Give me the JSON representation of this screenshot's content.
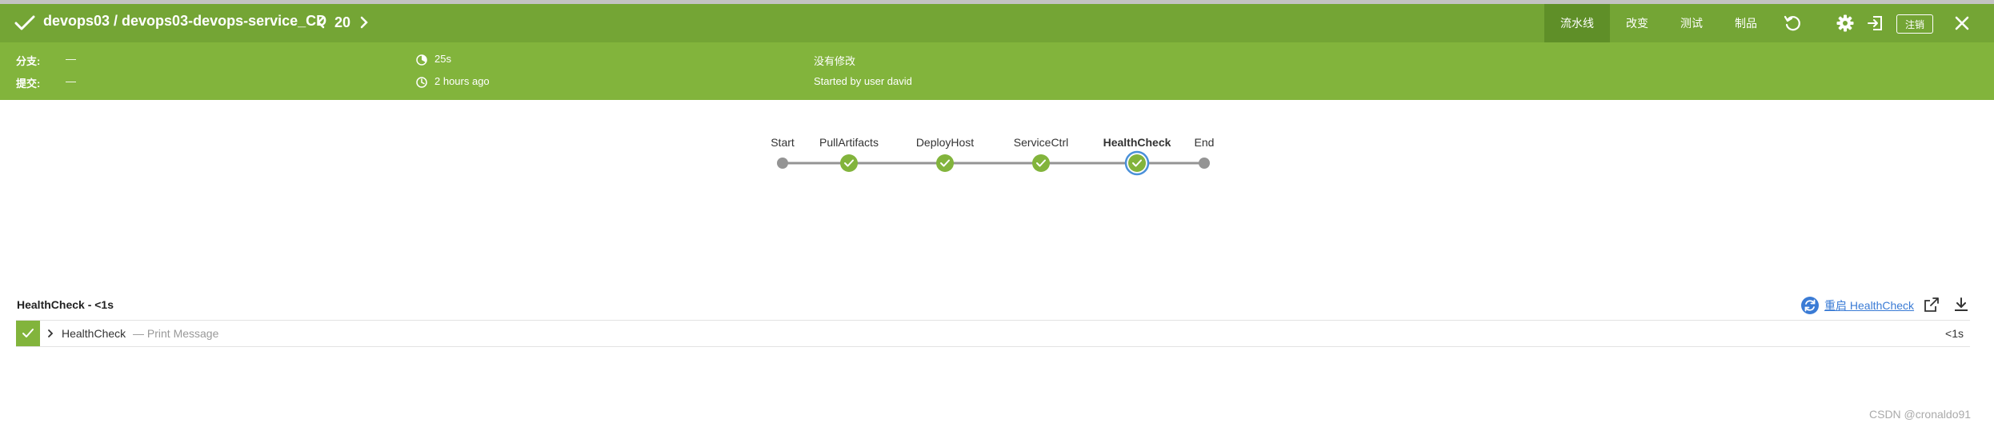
{
  "header": {
    "title": "devops03 / devops03-devops-service_CD",
    "run_number": "20",
    "tabs": [
      {
        "label": "流水线",
        "active": true
      },
      {
        "label": "改变",
        "active": false
      },
      {
        "label": "测试",
        "active": false
      },
      {
        "label": "制品",
        "active": false
      }
    ],
    "logout_label": "注销",
    "icons": [
      "check-icon",
      "chevron-left-icon",
      "chevron-right-icon",
      "replay-icon",
      "gear-icon",
      "exit-icon",
      "close-icon"
    ]
  },
  "info": {
    "branch_label": "分支:",
    "branch_value": "—",
    "commit_label": "提交:",
    "commit_value": "—",
    "duration": "25s",
    "time_ago": "2 hours ago",
    "changes": "没有修改",
    "cause": "Started by user david"
  },
  "pipeline": {
    "stages": [
      {
        "label": "Start",
        "status": "none",
        "selected": false
      },
      {
        "label": "PullArtifacts",
        "status": "success",
        "selected": false
      },
      {
        "label": "DeployHost",
        "status": "success",
        "selected": false
      },
      {
        "label": "ServiceCtrl",
        "status": "success",
        "selected": false
      },
      {
        "label": "HealthCheck",
        "status": "success",
        "selected": true
      },
      {
        "label": "End",
        "status": "none",
        "selected": false
      }
    ]
  },
  "step_detail": {
    "title": "HealthCheck - <1s",
    "restart_label": "重启 HealthCheck",
    "steps": [
      {
        "name": "HealthCheck",
        "description": "— Print Message",
        "duration": "<1s",
        "status": "success"
      }
    ]
  },
  "watermark": "CSDN @cronaldo91",
  "colors": {
    "header_bg": "#74a535",
    "infobar_bg": "#82b43c",
    "success": "#82b43c",
    "link": "#3a7bd5"
  }
}
